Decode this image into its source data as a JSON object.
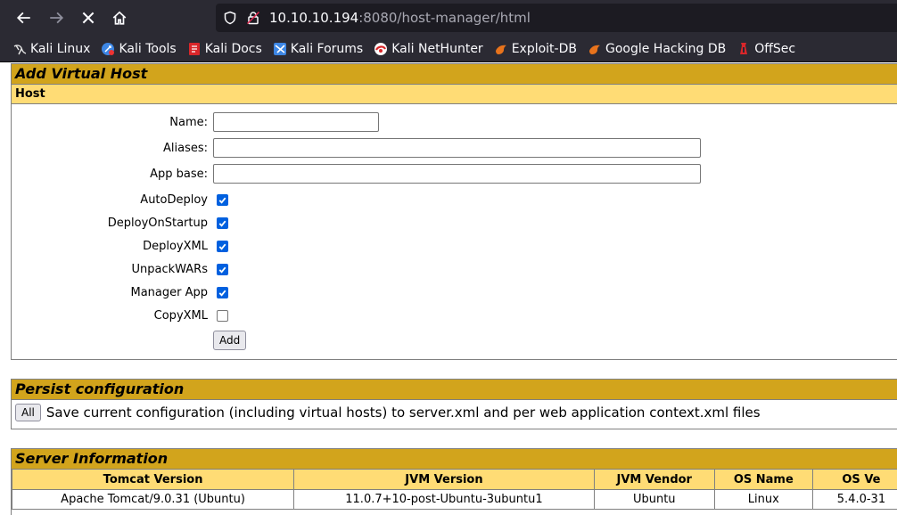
{
  "browser": {
    "url_host": "10.10.10.194",
    "url_rest": ":8080/host-manager/html",
    "bookmarks": [
      {
        "label": "Kali Linux",
        "icon": "kali-dragon-icon"
      },
      {
        "label": "Kali Tools",
        "icon": "kali-tools-icon"
      },
      {
        "label": "Kali Docs",
        "icon": "kali-docs-icon"
      },
      {
        "label": "Kali Forums",
        "icon": "kali-forums-icon"
      },
      {
        "label": "Kali NetHunter",
        "icon": "kali-nethunter-icon"
      },
      {
        "label": "Exploit-DB",
        "icon": "exploit-db-icon"
      },
      {
        "label": "Google Hacking DB",
        "icon": "ghdb-icon"
      },
      {
        "label": "OffSec",
        "icon": "offsec-icon"
      }
    ]
  },
  "add_host": {
    "title": "Add Virtual Host",
    "subtitle": "Host",
    "fields": {
      "name_label": "Name:",
      "name_value": "",
      "aliases_label": "Aliases:",
      "aliases_value": "",
      "appbase_label": "App base:",
      "appbase_value": ""
    },
    "checkboxes": [
      {
        "label": "AutoDeploy",
        "checked": true
      },
      {
        "label": "DeployOnStartup",
        "checked": true
      },
      {
        "label": "DeployXML",
        "checked": true
      },
      {
        "label": "UnpackWARs",
        "checked": true
      },
      {
        "label": "Manager App",
        "checked": true
      },
      {
        "label": "CopyXML",
        "checked": false
      }
    ],
    "add_button": "Add"
  },
  "persist": {
    "title": "Persist configuration",
    "button": "All",
    "description": "Save current configuration (including virtual hosts) to server.xml and per web application context.xml files"
  },
  "server_info": {
    "title": "Server Information",
    "headers": [
      "Tomcat Version",
      "JVM Version",
      "JVM Vendor",
      "OS Name",
      "OS Ve"
    ],
    "row": [
      "Apache Tomcat/9.0.31 (Ubuntu)",
      "11.0.7+10-post-Ubuntu-3ubuntu1",
      "Ubuntu",
      "Linux",
      "5.4.0-31"
    ]
  },
  "colors": {
    "section_title_bg": "#d2a41c",
    "sub_title_bg": "#ffdc75",
    "checkbox_on": "#0060df"
  }
}
